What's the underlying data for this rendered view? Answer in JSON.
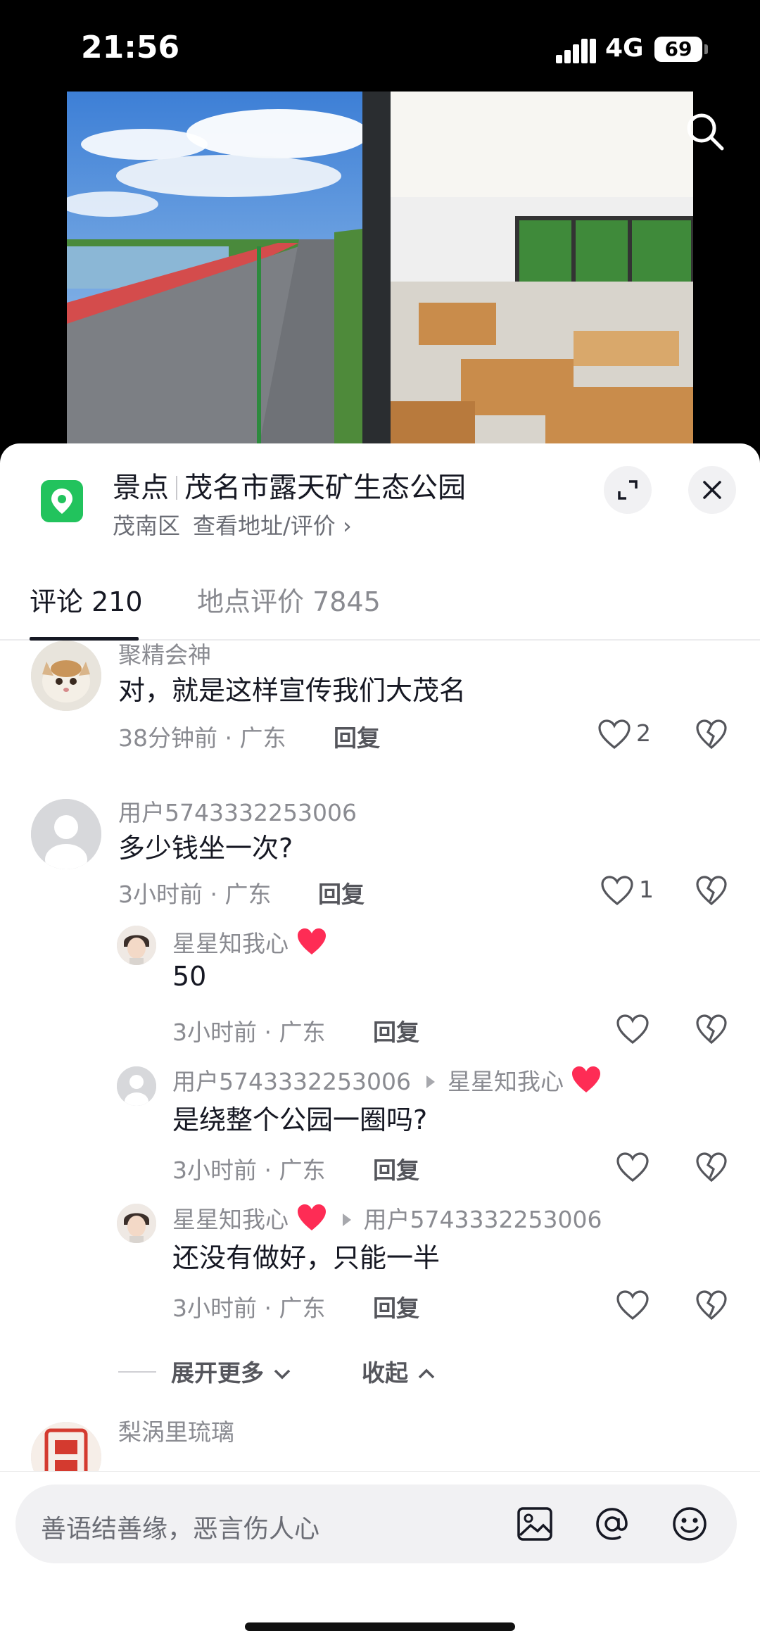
{
  "status_bar": {
    "time": "21:56",
    "network": "4G",
    "battery": "69"
  },
  "place": {
    "category": "景点",
    "name": "茂名市露天矿生态公园",
    "district": "茂南区",
    "link": "查看地址/评价 ›"
  },
  "tabs": {
    "comments": "评论 210",
    "reviews": "地点评价 7845"
  },
  "comments": [
    {
      "user": "聚精会神",
      "text": "对，就是这样宣传我们大茂名",
      "time": "38分钟前 · 广东",
      "reply": "回复",
      "likes": "2"
    },
    {
      "user": "用户5743332253006",
      "text": "多少钱坐一次?",
      "time": "3小时前 · 广东",
      "reply": "回复",
      "likes": "1"
    },
    {
      "user": "星星知我心",
      "text": "50",
      "time": "3小时前 · 广东",
      "reply": "回复"
    },
    {
      "user": "用户5743332253006",
      "reply_to": "星星知我心",
      "text": "是绕整个公园一圈吗?",
      "time": "3小时前 · 广东",
      "reply": "回复"
    },
    {
      "user": "星星知我心",
      "reply_to": "用户5743332253006",
      "text": "还没有做好，只能一半",
      "time": "3小时前 · 广东",
      "reply": "回复"
    },
    {
      "user": "梨涡里琉璃"
    }
  ],
  "thread_controls": {
    "expand": "展开更多",
    "collapse": "收起"
  },
  "input": {
    "placeholder": "善语结善缘，恶言伤人心"
  },
  "colors": {
    "location_green": "#22c35d",
    "heart_red": "#fe2c55"
  }
}
